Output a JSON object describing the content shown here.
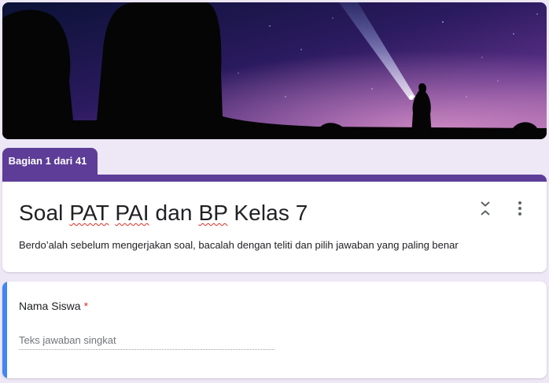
{
  "header": {
    "image": "night-sky-flashlight-banner"
  },
  "section_tab": {
    "label": "Bagian 1 dari 41"
  },
  "title_card": {
    "title_parts": [
      "Soal ",
      "PAT",
      " ",
      "PAI",
      " dan ",
      "BP",
      " Kelas 7"
    ],
    "description": "Berdo’alah sebelum mengerjakan soal, bacalah dengan teliti dan pilih jawaban yang paling benar",
    "icons": {
      "collapse": "collapse-icon",
      "more": "more-vert-icon"
    }
  },
  "question": {
    "label": "Nama Siswa",
    "required_mark": "*",
    "placeholder": "Teks jawaban singkat",
    "value": ""
  },
  "colors": {
    "theme": "#5d3d97",
    "accent": "#4285f4",
    "background": "#ede7f6",
    "required": "#d93025"
  }
}
